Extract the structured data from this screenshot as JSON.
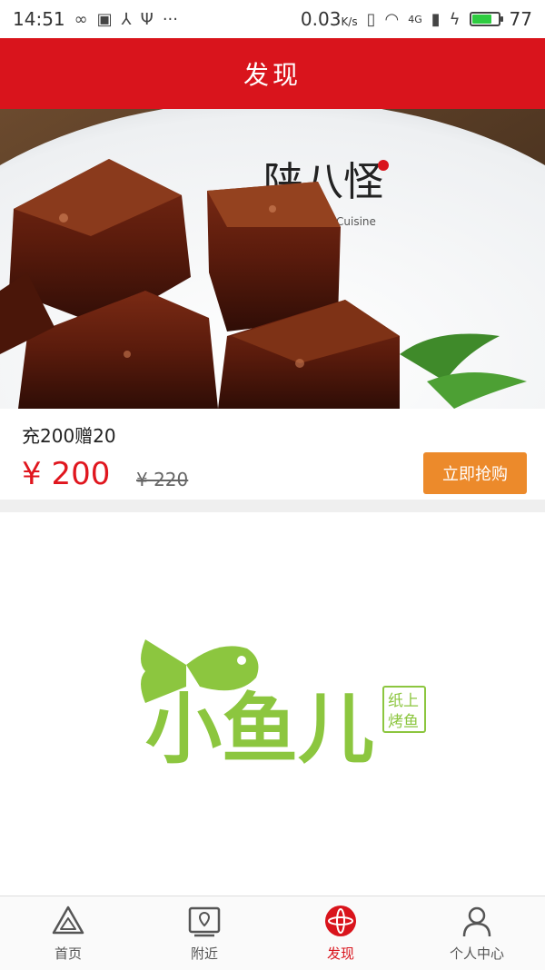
{
  "status_bar": {
    "time": "14:51",
    "speed": "0.03",
    "speed_unit": "K/s",
    "battery": "77",
    "network": "4G",
    "battery_level": 0.77
  },
  "header": {
    "title": "发现"
  },
  "product": {
    "name": "充200赠20",
    "price": "¥ 200",
    "original_price": "¥ 220",
    "buy_label": "立即抢购",
    "plate_brand": "陕八怪",
    "plate_subtext": "Cuisine"
  },
  "logo": {
    "main_text": "小鱼儿",
    "stamp_line1": "纸上",
    "stamp_line2": "烤鱼"
  },
  "tabs": [
    {
      "label": "首页",
      "icon": "home-icon"
    },
    {
      "label": "附近",
      "icon": "map-icon"
    },
    {
      "label": "发现",
      "icon": "discover-icon"
    },
    {
      "label": "个人中心",
      "icon": "user-icon"
    }
  ],
  "colors": {
    "brand_red": "#d9141c",
    "price_red": "#e0161e",
    "buy_orange": "#ec8a2b",
    "logo_green": "#8cc63f"
  }
}
